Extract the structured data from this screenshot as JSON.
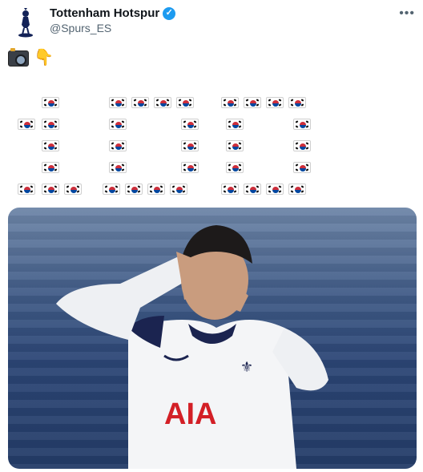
{
  "tweet": {
    "display_name": "Tottenham Hotspur",
    "handle": "@Spurs_ES",
    "verified": true,
    "more_icon": "more-icon",
    "emoji": [
      "camera-flash-icon",
      "point-down-icon"
    ],
    "flag_emoji": "south-korea-flag",
    "number_art": "100",
    "image": {
      "alt_subject": "footballer-making-camera-frame-gesture",
      "shirt_sponsor": "AIA"
    }
  },
  "colors": {
    "verified": "#1d9bf0",
    "handle": "#536471",
    "sponsor_red": "#d31f26"
  }
}
